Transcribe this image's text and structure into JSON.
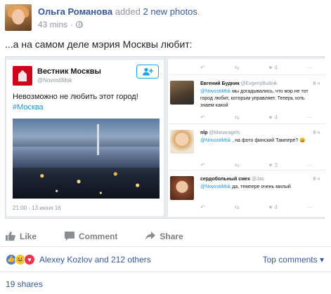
{
  "post": {
    "author": "Ольга Романова",
    "action_prefix": "added",
    "action_link": "2 new photos",
    "action_suffix": ".",
    "time": "43 mins",
    "dot": "·",
    "caption": "...а на самом деле мэрия Москвы любит:"
  },
  "tweet": {
    "account_name": "Вестник Москвы",
    "handle": "@NovostiMsk",
    "text": "Невозможно не любить этот город!",
    "hashtag": "#Москва",
    "date": "21:00 - 13 июня 16"
  },
  "replies_top_actions": {
    "likes": "4"
  },
  "replies": [
    {
      "name": "Евгений Будник",
      "handle": "@EvgenyBudnik",
      "time": "8 ч",
      "mention": "@NovostiMsk",
      "text": " мы догадывались, что мэр не тот город любит, которым управляет. Теперь хоть знаем какой",
      "retweets": "",
      "likes": "4"
    },
    {
      "name": "nlp",
      "handle": "@Manaragels",
      "time": "8 ч",
      "mention": "@NovostiMsk",
      "text": " , на фото финский Тампере? 😀",
      "retweets": "",
      "likes": "3"
    },
    {
      "name": "сердобольный смех",
      "handle": "@Jas",
      "time": "8 ч",
      "mention": "@NovostiMsk",
      "text": " да, темпере очень милый",
      "retweets": "",
      "likes": "4"
    }
  ],
  "actions": {
    "like": "Like",
    "comment": "Comment",
    "share": "Share"
  },
  "reactions": {
    "names": "Alexey Kozlov and 212 others",
    "top_comments": "Top comments ▾"
  },
  "shares": "19 shares",
  "icons": [
    "reply-icon",
    "retweet-icon",
    "heart-icon",
    "more-icon",
    "globe-icon",
    "follow-icon",
    "like-icon",
    "comment-icon",
    "share-icon"
  ]
}
